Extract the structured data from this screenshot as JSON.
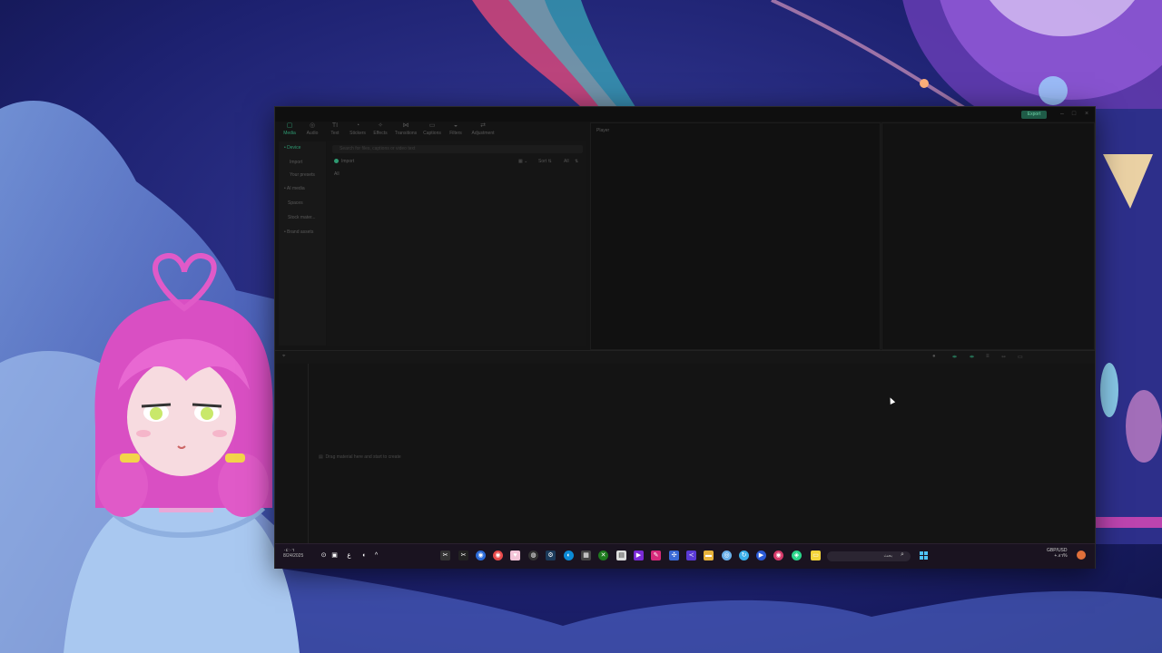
{
  "window": {
    "export_label": "Export",
    "controls": [
      "–",
      "□",
      "×"
    ]
  },
  "toolbar": {
    "tabs": [
      {
        "label": "Media",
        "icon": "▢"
      },
      {
        "label": "Audio",
        "icon": "◎"
      },
      {
        "label": "Text",
        "icon": "TI"
      },
      {
        "label": "Stickers",
        "icon": "◔"
      },
      {
        "label": "Effects",
        "icon": "✧"
      },
      {
        "label": "Transitions",
        "icon": "⋈"
      },
      {
        "label": "Captions",
        "icon": "▭"
      },
      {
        "label": "Filters",
        "icon": "◒"
      },
      {
        "label": "Adjustment",
        "icon": "⇄"
      }
    ]
  },
  "leftnav": {
    "items": [
      "• Device",
      "Import",
      "Your presets",
      "• AI media",
      "Spaces",
      "Stock mater...",
      "• Brand assets"
    ]
  },
  "media": {
    "search_placeholder": "Search for files, captions or video text",
    "import_label": "Import",
    "view_icon": "▦ ⌄",
    "sort_label": "Sort ⇅",
    "filter_label": "All",
    "filter_icon": "⇅",
    "all_tab": "All"
  },
  "player": {
    "title": "Player"
  },
  "timeline": {
    "drag_hint": "Drag material here and start to create",
    "drag_icon": "▤"
  },
  "taskbar": {
    "time": "٠٤:٠٦",
    "date": "8/24/2025",
    "lang": "ع",
    "search_placeholder": "بحث",
    "ticker_pair": "GBP/USD",
    "ticker_value": "+.٨٦%"
  }
}
